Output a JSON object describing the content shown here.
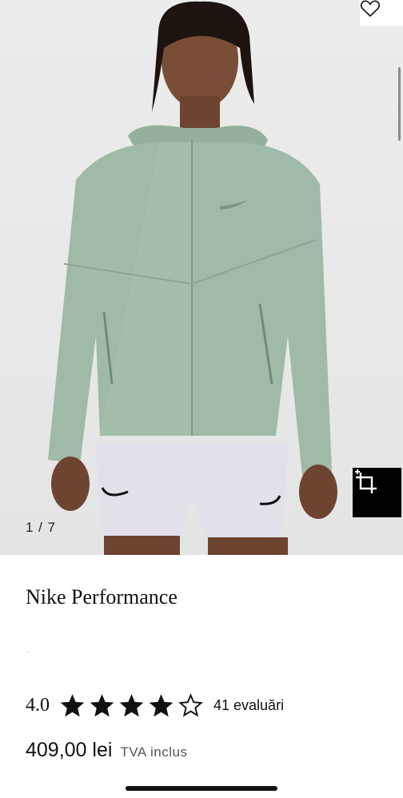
{
  "gallery": {
    "counter": "1 / 7",
    "image_alt": "Man wearing light green Nike running jacket and grey running shorts"
  },
  "product": {
    "brand": "Nike Performance",
    "rating": "4.0",
    "rating_value": 4,
    "rating_max": 5,
    "reviews": "41 evaluări",
    "price": "409,00 lei",
    "vat_note": "TVA inclus"
  },
  "icons": {
    "favorite": "heart-icon",
    "ar": "try-on-icon",
    "star_full": "star-filled-icon",
    "star_empty": "star-outline-icon"
  },
  "colors": {
    "jacket": "#9fbaa6",
    "shorts": "#e4e0ea",
    "ar_button_bg": "#000000",
    "text": "#111111"
  }
}
